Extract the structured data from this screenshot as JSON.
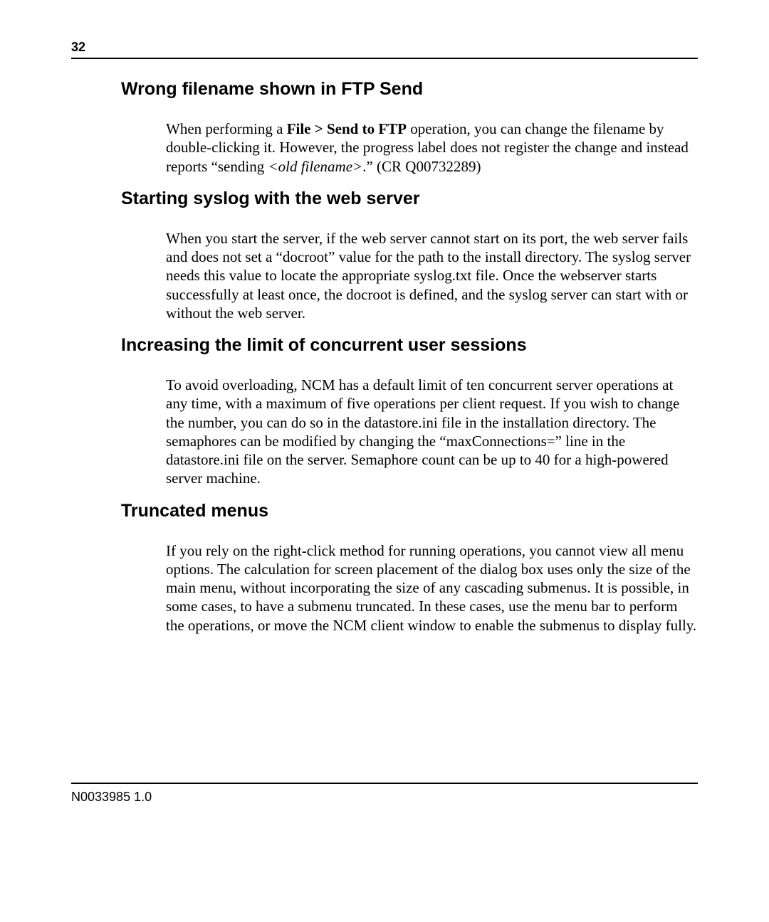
{
  "page_number": "32",
  "sections": [
    {
      "heading": "Wrong filename shown in FTP Send",
      "para_pre": "When performing a ",
      "bold_part": "File > Send to FTP",
      "para_mid": " operation, you can change the filename by double-clicking it. However, the progress label does not register the change and instead reports “sending ",
      "italic_part": "<old filename>",
      "para_post": ".” (CR Q00732289)"
    },
    {
      "heading": "Starting syslog with the web server",
      "para": "When you start the server, if the web server cannot start on its port, the web server fails and does not set a “docroot” value for the path to the install directory. The syslog server needs this value to locate the appropriate syslog.txt file. Once the webserver starts successfully at least once, the docroot is defined, and the syslog server can start with or without the web server."
    },
    {
      "heading": "Increasing the limit of concurrent user sessions",
      "para": "To avoid overloading, NCM has a default limit of ten concurrent server operations at any time, with a maximum of five operations per client request. If you wish to change the number, you can do so in the datastore.ini file in the installation directory. The semaphores can be modified by changing the “maxConnections=” line in the datastore.ini file on the server. Semaphore count can be up to 40 for a high-powered server machine."
    },
    {
      "heading": "Truncated menus",
      "para": "If you rely on the right-click method for running operations, you cannot view all menu options. The calculation for screen placement of the dialog box uses only the size of the main menu, without incorporating the size of any cascading submenus. It is possible, in some cases, to have a submenu truncated. In these cases, use the menu bar to perform the operations, or move the NCM client window to enable the submenus to display fully."
    }
  ],
  "footer": "N0033985 1.0"
}
